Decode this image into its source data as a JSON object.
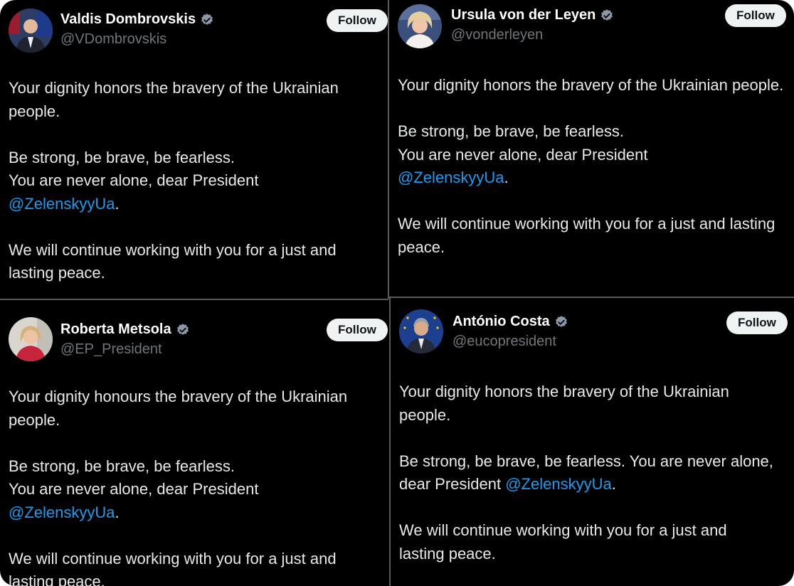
{
  "follow_label": "Follow",
  "colors": {
    "background": "#000000",
    "text": "#e7e9ea",
    "handle": "#71767b",
    "mention": "#1d9bf0",
    "verified": "#8b98a5",
    "follow_bg": "#eff3f4"
  },
  "tweets": [
    {
      "name": "Valdis Dombrovskis",
      "handle": "@VDombrovskis",
      "para1": "Your dignity honors the bravery of the Ukrainian people.",
      "para2_line1": "Be strong, be brave, be fearless.",
      "para2_line2": "You are never alone, dear President",
      "mention": "@ZelenskyyUa",
      "period": ".",
      "para3": "We will continue working with you for a just and lasting peace."
    },
    {
      "name": "Ursula von der Leyen",
      "handle": "@vonderleyen",
      "para1": "Your dignity honors the bravery of the Ukrainian people.",
      "para2_line1": "Be strong, be brave, be fearless.",
      "para2_line2": "You are never alone, dear President",
      "mention": "@ZelenskyyUa",
      "period": ".",
      "para3": "We will continue working with you for a just and lasting peace."
    },
    {
      "name": "Roberta Metsola",
      "handle": "@EP_President",
      "para1": "Your dignity honours the bravery of the Ukrainian people.",
      "para2_line1": "Be strong, be brave, be fearless.",
      "para2_line2": "You are never alone, dear President",
      "mention": "@ZelenskyyUa",
      "period": ".",
      "para3": "We will continue working with you for a just and lasting peace."
    },
    {
      "name": "António Costa",
      "handle": "@eucopresident",
      "para1": "Your dignity honors the bravery of the Ukrainian people.",
      "para2_text": "Be strong, be brave, be fearless. You are never alone, dear President ",
      "mention": "@ZelenskyyUa",
      "period": ".",
      "para3": "We will continue working with you for a just and lasting peace."
    }
  ]
}
